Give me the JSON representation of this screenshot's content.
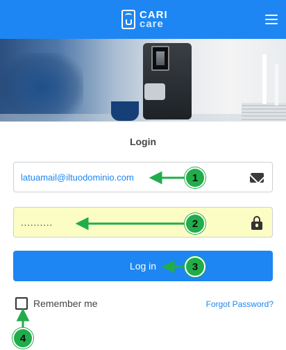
{
  "header": {
    "brand_top": "CARI",
    "brand_bottom": "care",
    "brand_icon": "coffee-machine-wifi-icon",
    "menu_icon": "hamburger-menu-icon",
    "background_color": "#1d86f2"
  },
  "login": {
    "title": "Login",
    "email_value": "latuamail@iltuodominio.com",
    "email_icon": "envelope-icon",
    "password_value": "..........",
    "password_icon": "lock-icon",
    "submit_label": "Log in",
    "remember_label": "Remember me",
    "forgot_label": "Forgot Password?"
  },
  "annotations": {
    "markers": [
      "1",
      "2",
      "3",
      "4"
    ],
    "color": "#21ad4a"
  }
}
